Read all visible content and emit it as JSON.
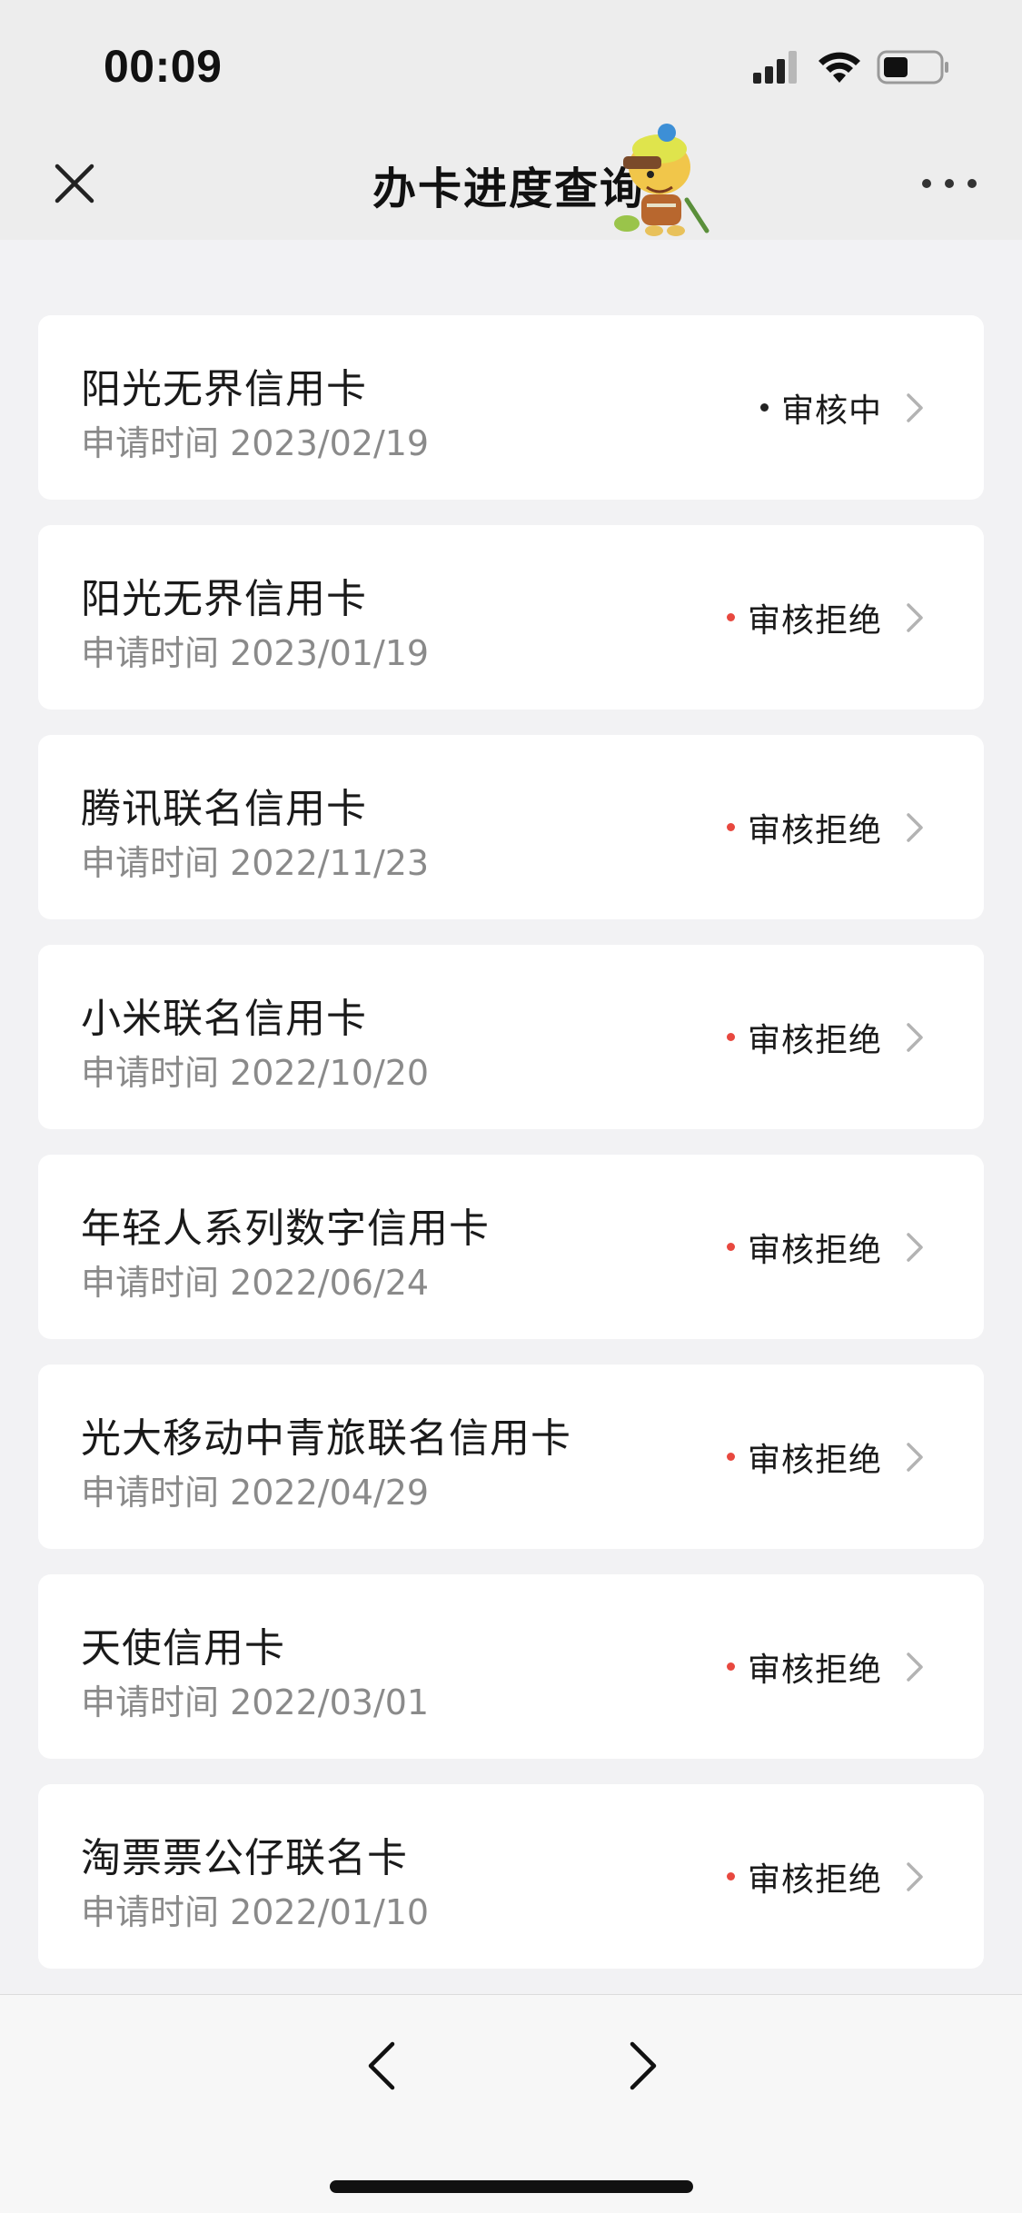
{
  "status_bar": {
    "time": "00:09",
    "icons": [
      "signal-icon",
      "wifi-icon",
      "battery-icon"
    ]
  },
  "nav": {
    "title": "办卡进度查询",
    "close_icon": "close-icon",
    "more_icon": "more-icon"
  },
  "colors": {
    "pending_dot": "#222222",
    "rejected_dot": "#e8483f",
    "background": "#f2f2f4",
    "card": "#ffffff"
  },
  "applications": [
    {
      "name": "阳光无界信用卡",
      "date": "申请时间 2023/02/19",
      "status": "审核中",
      "status_type": "pending"
    },
    {
      "name": "阳光无界信用卡",
      "date": "申请时间 2023/01/19",
      "status": "审核拒绝",
      "status_type": "rejected"
    },
    {
      "name": "腾讯联名信用卡",
      "date": "申请时间 2022/11/23",
      "status": "审核拒绝",
      "status_type": "rejected"
    },
    {
      "name": "小米联名信用卡",
      "date": "申请时间 2022/10/20",
      "status": "审核拒绝",
      "status_type": "rejected"
    },
    {
      "name": "年轻人系列数字信用卡",
      "date": "申请时间 2022/06/24",
      "status": "审核拒绝",
      "status_type": "rejected"
    },
    {
      "name": "光大移动中青旅联名信用卡",
      "date": "申请时间 2022/04/29",
      "status": "审核拒绝",
      "status_type": "rejected"
    },
    {
      "name": "天使信用卡",
      "date": "申请时间 2022/03/01",
      "status": "审核拒绝",
      "status_type": "rejected"
    },
    {
      "name": "淘票票公仔联名卡",
      "date": "申请时间 2022/01/10",
      "status": "审核拒绝",
      "status_type": "rejected"
    }
  ],
  "bottom_nav": {
    "back_icon": "chevron-left-icon",
    "forward_icon": "chevron-right-icon"
  }
}
